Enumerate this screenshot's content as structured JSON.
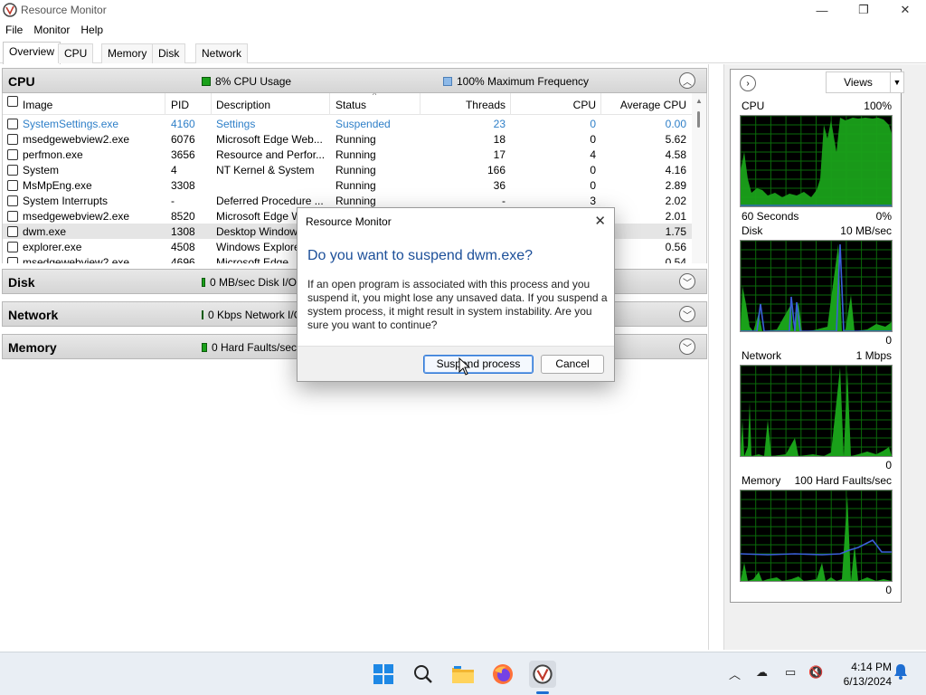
{
  "window": {
    "title": "Resource Monitor",
    "min": "—",
    "max": "❐",
    "close": "✕"
  },
  "menu": [
    "File",
    "Monitor",
    "Help"
  ],
  "tabs": [
    "Overview",
    "CPU",
    "Memory",
    "Disk",
    "Network"
  ],
  "active_tab": "Overview",
  "cpu_section": {
    "title": "CPU",
    "usage": "8% CPU Usage",
    "frequency": "100% Maximum Frequency",
    "columns": [
      "Image",
      "PID",
      "Description",
      "Status",
      "Threads",
      "CPU",
      "Average CPU"
    ],
    "rows": [
      {
        "image": "SystemSettings.exe",
        "pid": "4160",
        "description": "Settings",
        "status": "Suspended",
        "threads": "23",
        "cpu": "0",
        "avg_cpu": "0.00"
      },
      {
        "image": "msedgewebview2.exe",
        "pid": "6076",
        "description": "Microsoft Edge Web...",
        "status": "Running",
        "threads": "18",
        "cpu": "0",
        "avg_cpu": "5.62"
      },
      {
        "image": "perfmon.exe",
        "pid": "3656",
        "description": "Resource and Perfor...",
        "status": "Running",
        "threads": "17",
        "cpu": "4",
        "avg_cpu": "4.58"
      },
      {
        "image": "System",
        "pid": "4",
        "description": "NT Kernel & System",
        "status": "Running",
        "threads": "166",
        "cpu": "0",
        "avg_cpu": "4.16"
      },
      {
        "image": "MsMpEng.exe",
        "pid": "3308",
        "description": "",
        "status": "Running",
        "threads": "36",
        "cpu": "0",
        "avg_cpu": "2.89"
      },
      {
        "image": "System Interrupts",
        "pid": "-",
        "description": "Deferred Procedure ...",
        "status": "Running",
        "threads": "-",
        "cpu": "3",
        "avg_cpu": "2.02"
      },
      {
        "image": "msedgewebview2.exe",
        "pid": "8520",
        "description": "Microsoft Edge W",
        "status": "",
        "threads": "",
        "cpu": "",
        "avg_cpu": "2.01"
      },
      {
        "image": "dwm.exe",
        "pid": "1308",
        "description": "Desktop Window",
        "status": "",
        "threads": "",
        "cpu": "",
        "avg_cpu": "1.75"
      },
      {
        "image": "explorer.exe",
        "pid": "4508",
        "description": "Windows Explore",
        "status": "",
        "threads": "",
        "cpu": "",
        "avg_cpu": "0.56"
      },
      {
        "image": "msedgewebview2.exe",
        "pid": "4696",
        "description": "Microsoft Edge",
        "status": "",
        "threads": "",
        "cpu": "",
        "avg_cpu": "0.54"
      }
    ]
  },
  "disk_section": {
    "title": "Disk",
    "stat": "0 MB/sec Disk I/O"
  },
  "network_section": {
    "title": "Network",
    "stat": "0 Kbps Network I/O"
  },
  "memory_section": {
    "title": "Memory",
    "stat": "0 Hard Faults/sec"
  },
  "right_panel": {
    "views_label": "Views",
    "graphs": [
      {
        "name": "CPU",
        "scale": "100%",
        "footer_left": "60 Seconds",
        "footer_right": "0%"
      },
      {
        "name": "Disk",
        "scale": "10 MB/sec",
        "footer_left": "",
        "footer_right": "0"
      },
      {
        "name": "Network",
        "scale": "1 Mbps",
        "footer_left": "",
        "footer_right": "0"
      },
      {
        "name": "Memory",
        "scale": "100 Hard Faults/sec",
        "footer_left": "",
        "footer_right": "0"
      }
    ]
  },
  "dialog": {
    "title": "Resource Monitor",
    "heading": "Do you want to suspend dwm.exe?",
    "body": "If an open program is associated with this process and you suspend it, you might lose any unsaved data. If you suspend a system process, it might result in system instability. Are you sure you want to continue?",
    "primary_button": "Suspend process",
    "cancel_button": "Cancel"
  },
  "taskbar": {
    "time": "4:14 PM",
    "date": "6/13/2024",
    "apps": [
      "start",
      "search",
      "file-explorer",
      "firefox",
      "resource-monitor"
    ]
  },
  "colors": {
    "accent": "#1c4f99",
    "graph_green": "#1aa11a",
    "graph_blue": "#3a5fd8",
    "suspended": "#2e7fc8"
  }
}
